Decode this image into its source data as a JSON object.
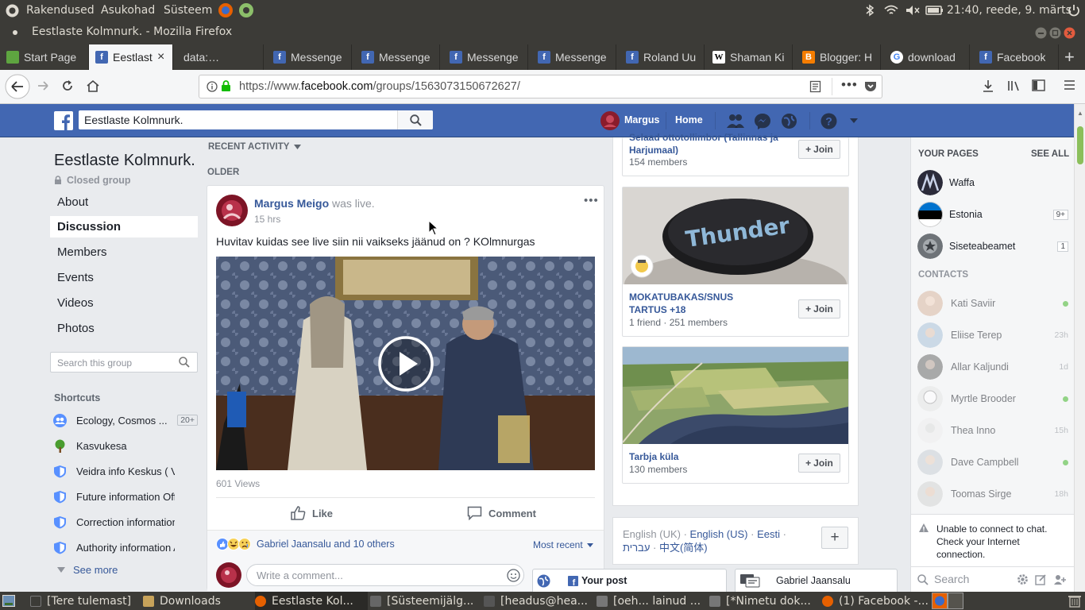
{
  "os_panel": {
    "menu": [
      "Rakendused",
      "Asukohad",
      "Süsteem"
    ],
    "clock": "21:40, reede, 9. märts"
  },
  "window": {
    "title": "Eestlaste Kolmnurk. - Mozilla Firefox"
  },
  "tabs": [
    {
      "label": "Start Page",
      "icon": "start-page-icon",
      "color": "#5ea540"
    },
    {
      "label": "Eestlast",
      "icon": "facebook-icon",
      "color": "#4267b2"
    },
    {
      "label": "data:…",
      "icon": "none",
      "color": ""
    },
    {
      "label": "Messenge",
      "icon": "facebook-icon",
      "color": "#4267b2"
    },
    {
      "label": "Messenge",
      "icon": "facebook-icon",
      "color": "#4267b2"
    },
    {
      "label": "Messenge",
      "icon": "facebook-icon",
      "color": "#4267b2"
    },
    {
      "label": "Messenge",
      "icon": "facebook-icon",
      "color": "#4267b2"
    },
    {
      "label": "Roland Uu",
      "icon": "facebook-icon",
      "color": "#4267b2"
    },
    {
      "label": "Shaman Ki",
      "icon": "wikipedia-icon",
      "color": "#ffffff"
    },
    {
      "label": "Blogger: H",
      "icon": "blogger-icon",
      "color": "#f57d00"
    },
    {
      "label": "download",
      "icon": "google-icon",
      "color": "#ffffff"
    },
    {
      "label": "Facebook",
      "icon": "facebook-icon",
      "color": "#4267b2"
    }
  ],
  "url": {
    "prefix": "https://www.",
    "domain": "facebook.com",
    "path": "/groups/1563073150672627/"
  },
  "fb": {
    "search_value": "Eestlaste Kolmnurk.",
    "user": "Margus",
    "home": "Home",
    "brand_color": "#4267b2"
  },
  "group": {
    "name": "Eestlaste Kolmnurk.",
    "privacy": "Closed group",
    "nav": [
      "About",
      "Discussion",
      "Members",
      "Events",
      "Videos",
      "Photos"
    ],
    "active_nav": "Discussion",
    "search_placeholder": "Search this group",
    "shortcuts_title": "Shortcuts",
    "shortcuts": [
      {
        "label": "Ecology, Cosmos ...",
        "badge": "20+",
        "icon": "group-icon"
      },
      {
        "label": "Kasvukesa",
        "badge": "",
        "icon": "tree-icon"
      },
      {
        "label": "Veidra info Keskus ( V.i...",
        "badge": "",
        "icon": "shield-icon"
      },
      {
        "label": "Future information Offic...",
        "badge": "",
        "icon": "shield-icon"
      },
      {
        "label": "Correction information ...",
        "badge": "",
        "icon": "shield-icon"
      },
      {
        "label": "Authority information A...",
        "badge": "",
        "icon": "shield-icon"
      }
    ],
    "see_more": "See more"
  },
  "feed": {
    "recent": "RECENT ACTIVITY",
    "older": "OLDER",
    "post": {
      "author": "Margus Meigo",
      "action": "was live.",
      "time": "15 hrs",
      "text": "Huvitav kuidas see live siin nii vaikseks jäänud on ? KOlmnurgas",
      "views": "601 Views",
      "like": "Like",
      "comment": "Comment",
      "reactions": "Gabriel Jaansalu and 10 others",
      "sort": "Most recent",
      "comment_placeholder": "Write a comment..."
    }
  },
  "suggested_groups": [
    {
      "name": "Selaad ottotollimbor (Tallinnas ja Harjumaal)",
      "members": "154 members",
      "join": "Join"
    },
    {
      "name": "MOKATUBAKAS/SNUS TARTUS +18",
      "members": "1 friend · 251 members",
      "join": "Join"
    },
    {
      "name": "Tarbja küla",
      "members": "130 members",
      "join": "Join"
    }
  ],
  "languages": {
    "current": "English (UK)",
    "others": [
      "English (US)",
      "Eesti",
      "עברית",
      "中文(简体)"
    ]
  },
  "sidebar": {
    "pages_title": "YOUR PAGES",
    "see_all": "SEE ALL",
    "pages": [
      {
        "name": "Waffa",
        "badge": ""
      },
      {
        "name": "Estonia",
        "badge": "9+"
      },
      {
        "name": "Siseteabeamet",
        "badge": "1"
      }
    ],
    "contacts_title": "CONTACTS",
    "contacts": [
      {
        "name": "Kati Saviir",
        "status": "online"
      },
      {
        "name": "Eliise Terep",
        "status": "23h"
      },
      {
        "name": "Allar Kaljundi",
        "status": "1d"
      },
      {
        "name": "Myrtle Brooder",
        "status": "online"
      },
      {
        "name": "Thea Inno",
        "status": "15h"
      },
      {
        "name": "Dave Campbell",
        "status": "online"
      },
      {
        "name": "Toomas Sirge",
        "status": "18h"
      }
    ],
    "chat_error": "Unable to connect to chat. Check your Internet connection.",
    "search_placeholder": "Search"
  },
  "chat_tabs": {
    "post": "Your post",
    "person": "Gabriel Jaansalu"
  },
  "taskbar": [
    {
      "label": "[Tere tulemast]",
      "color": "#3c3b37"
    },
    {
      "label": "Downloads",
      "color": "#c8a35a"
    },
    {
      "label": "Eestlaste Kol...",
      "color": "#e66000"
    },
    {
      "label": "[Süsteemijälg...",
      "color": "#666666"
    },
    {
      "label": "[headus@hea...",
      "color": "#555555"
    },
    {
      "label": "[oeh... lainud ...",
      "color": "#777777"
    },
    {
      "label": "[*Nimetu dok...",
      "color": "#777777"
    },
    {
      "label": "(1) Facebook -...",
      "color": "#e66000"
    }
  ]
}
